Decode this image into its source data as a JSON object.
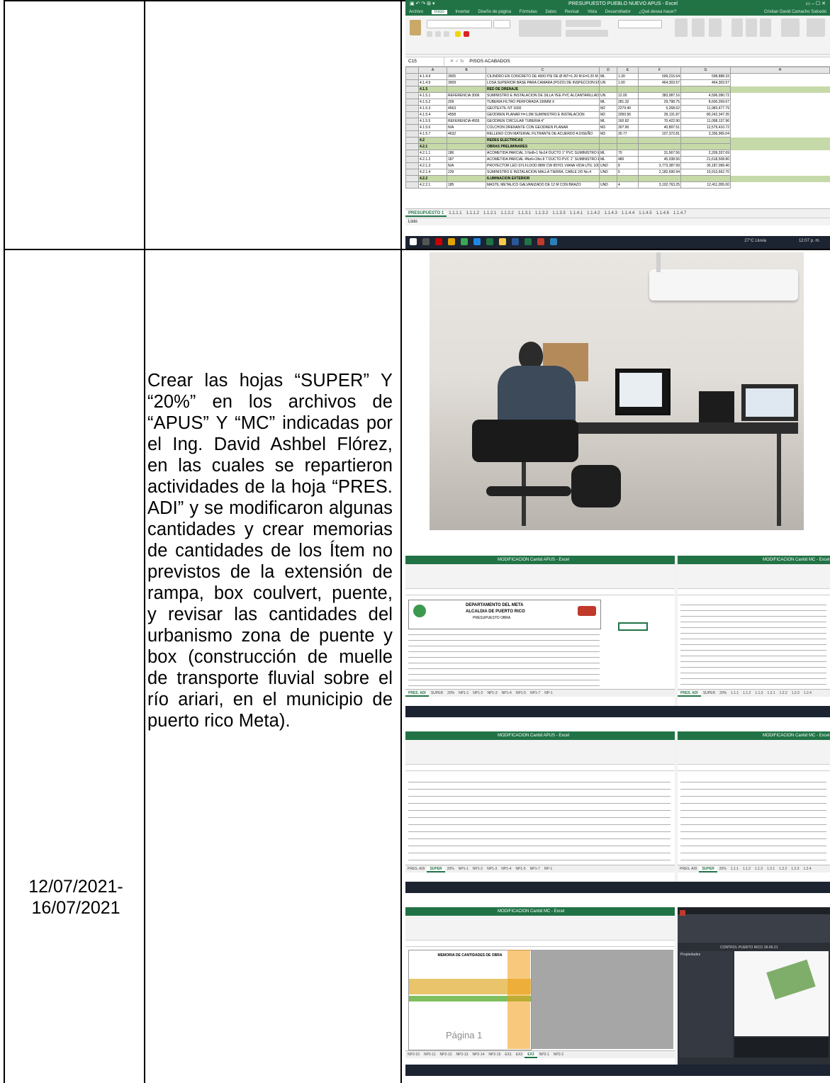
{
  "row1": {
    "excel": {
      "window_title": "PRESUPUESTO PUEBLO NUEVO APUS - Excel",
      "user": "Cristian David Camacho Salcedo",
      "ribbon_tabs": [
        "Archivo",
        "Inicio",
        "Insertar",
        "Diseño de página",
        "Fórmulas",
        "Datos",
        "Revisar",
        "Vista",
        "Desarrollador",
        "¿Qué desea hacer?"
      ],
      "active_tab": "Inicio",
      "name_box": "C15",
      "formula": "PISOS ACABADOS",
      "column_headers": [
        "A",
        "B",
        "C",
        "D",
        "E",
        "F",
        "G",
        "H"
      ],
      "rows": [
        [
          "4.1.4.9",
          "3005",
          "CILINDRO EN CONCRETO DE 4000 PSI DE Ø INT=1.20 M E=0.20 M FUNDIDO EN SITIO PARA CAMARA DE INSPECCION. INCLUYE PELDAÑOS",
          "ML",
          "1.30",
          "599,215.64",
          "598,888.33"
        ],
        [
          "4.1.4.9",
          "3009",
          "LOSA SUPERIOR BASE PARA CAMARA (POZO) DE INSPECCION EN CONCRETO DE 4000 PSI. INCLUYE CAÑUELAS",
          "UN",
          "1.00",
          "464,303.57",
          "464,303.57"
        ],
        [
          "4.1.5",
          "",
          "RED DE DRENAJE",
          "",
          "",
          "",
          ""
        ],
        [
          "4.1.5.1",
          "REFERENCIA 3006",
          "SUMINISTRO E INSTALACION DE SILLA YEE PVC ALCANTARILLADO",
          "UN",
          "12.00",
          "383,087.16",
          "4,596,090.72"
        ],
        [
          "4.1.5.2",
          "209",
          "TUBERIA FILTRO PERFORADA 100MM X",
          "ML",
          "281.32",
          "29,798.75",
          "8,600,269.67"
        ],
        [
          "4.1.5.3",
          "4563",
          "GEOTEXTIL NT 1600",
          "M2",
          "2279.40",
          "5,268.62",
          "11,983,477.79"
        ],
        [
          "4.1.5.4",
          "4558",
          "GEODREN PLANAR H=1.0M SUMINISTRO E INSTALACION",
          "M2",
          "2050.56",
          "39,131.87",
          "80,242,347.35"
        ],
        [
          "4.1.5.5",
          "REFERENCIA 4555",
          "GEODREN CIRCULAR TUBERIA 4\"",
          "ML",
          "160.82",
          "70,422.90",
          "11,098,137.96"
        ],
        [
          "4.1.5.6",
          "N/A",
          "COLCHON DRENANTE CON GEODREN PLANAR",
          "M3",
          "307.90",
          "40,897.51",
          "12,579,410.72"
        ],
        [
          "4.1.5.7",
          "4632",
          "RELLENO CON MATERIAL FILTRANTE DE ACUERDO A DISEÑO",
          "M3",
          "30.77",
          "107,372.81",
          "3,336,965.04"
        ],
        [
          "4.2",
          "",
          "REDES ELECTRICAS",
          "",
          "",
          "",
          ""
        ],
        [
          "4.2.1",
          "",
          "OBRAS PRELIMINARES",
          "",
          "",
          "",
          ""
        ],
        [
          "4.2.1.1",
          "186",
          "ACOMETIDA PARCIAL 3 No8+1 No14 DUCTO 1\" PVC SUMINISTRO E INSTALACION",
          "ML",
          "70",
          "31,567.56",
          "2,209,337.69"
        ],
        [
          "4.2.1.2",
          "187",
          "ACOMETIDA PARCIAL 4No6+1No.8 T DUCTO PVC 1\" SUMINISTRO E INSTALACION",
          "ML",
          "480",
          "45,038.56",
          "21,618,508.80"
        ],
        [
          "4.2.1.3",
          "N/A",
          "PROYECTOR LED SYLFLOOD 88W CW 85Y01 VIANA VIDA UTIL 100000h SUMINISTRO E INSTALACION",
          "UND",
          "8",
          "3,773,387.99",
          "30,187,099.40"
        ],
        [
          "4.2.1.4",
          "239",
          "SUMINISTRO E INSTALACION MALLA TIERRA, CABLE 2/0 No.4",
          "UND",
          "5",
          "2,182,690.94",
          "10,913,662.70"
        ],
        [
          "4.2.2",
          "",
          "ILUMINACION EXTERIOR",
          "",
          "",
          "",
          ""
        ],
        [
          "4.2.2.1",
          "185",
          "MASTIL METALICO GALVANIZADO DE 12 M CON BRAZO",
          "UND",
          "4",
          "3,102,763.25",
          "12,411,055.00"
        ]
      ],
      "sheet_tabs": [
        "PRESUPUESTO 1",
        "1.1.1.1",
        "1.1.1.2",
        "1.1.2.1",
        "1.1.2.2",
        "1.1.3.1",
        "1.1.3.2",
        "1.1.3.3",
        "1.1.4.1",
        "1.1.4.2",
        "1.1.4.3",
        "1.1.4.4",
        "1.1.4.5",
        "1.1.4.6",
        "1.1.4.7"
      ],
      "status": "Listo",
      "tray": "27°C Lluvia",
      "clock": "12:07 p. m."
    }
  },
  "row2": {
    "date": "12/07/2021-16/07/2021",
    "description": "Crear las hojas “SUPER” Y “20%” en los archivos de “APUS” Y “MC” indicadas por el Ing. David Ashbel Flórez, en las cuales se repartieron actividades de la hoja “PRES. ADI” y se modificaron algunas cantidades y crear memorias de cantidades de los Ítem no previstos de la extensión de rampa, box coulvert, puente, y revisar las cantidades del urbanismo zona de puente y box (construcción de muelle de transporte fluvial sobre el río ariari, en el municipio de puerto rico Meta).",
    "shot2": {
      "left_title": "MODIFICACION Cantid APUS - Excel",
      "right_title": "MODIFICACION Cantid MC - Excel",
      "dept": "DEPARTAMENTO DEL META",
      "city": "ALCALDIA DE PUERTO RICO",
      "subtitle": "PRESUPUESTO OBRA",
      "left_tabs": [
        "PRES. ADI",
        "SUPER",
        "20%",
        "NP1-1",
        "NP1-2",
        "NP1-3",
        "NP1-4",
        "NP1-5",
        "NP1-7",
        "NP-1"
      ],
      "right_tabs": [
        "PRES. ADI",
        "SUPER",
        "20%",
        "1.1.1",
        "1.1.2",
        "1.1.3",
        "1.2.1",
        "1.2.2",
        "1.2.3",
        "1.2.4"
      ]
    },
    "shot3": {
      "left_title": "MODIFICACION Cantid APUS - Excel",
      "right_title": "MODIFICACION Cantid MC - Excel",
      "left_tabs": [
        "PRES. ADI",
        "SUPER",
        "20%",
        "NP1-1",
        "NP1-2",
        "NP1-3",
        "NP1-4",
        "NP1-5",
        "NP1-7",
        "NP-1"
      ],
      "right_tabs": [
        "PRES. ADI",
        "SUPER",
        "20%",
        "1.1.1",
        "1.1.2",
        "1.1.3",
        "1.2.1",
        "1.2.2",
        "1.2.3",
        "1.2.4"
      ]
    },
    "shot4": {
      "left_title": "MODIFICACION Cantid MC - Excel",
      "memoria_title": "MEMORIA DE CANTIDADES DE OBRA",
      "page_watermark": "Página 1",
      "left_tabs": [
        "NP2-10",
        "NP2-11",
        "NP2-12",
        "NP2-13",
        "NP2-14",
        "NP2-15",
        "EX1",
        "EX2",
        "EX3",
        "NP2-1",
        "NP2-2"
      ],
      "cad_title": "CONTROL PUERTO RICO 18-06-21",
      "cad_panel": "Propiedades"
    }
  }
}
